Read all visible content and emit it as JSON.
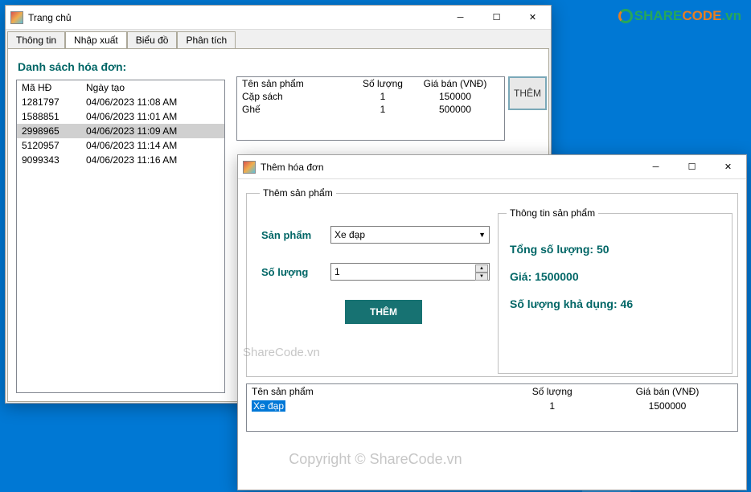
{
  "logo": {
    "text1": "SHARE",
    "text2": "CODE",
    "ext": ".vn"
  },
  "watermarks": {
    "center": "Copyright © ShareCode.vn",
    "small": "ShareCode.vn"
  },
  "mainWindow": {
    "title": "Trang chủ",
    "tabs": [
      "Thông tin",
      "Nhập xuất",
      "Biểu đồ",
      "Phân tích"
    ],
    "sectionTitle": "Danh sách hóa đơn:",
    "listHeaders": {
      "id": "Mã HĐ",
      "date": "Ngày tạo"
    },
    "invoices": [
      {
        "id": "1281797",
        "date": "04/06/2023 11:08 AM"
      },
      {
        "id": "1588851",
        "date": "04/06/2023 11:01 AM"
      },
      {
        "id": "2998965",
        "date": "04/06/2023 11:09 AM"
      },
      {
        "id": "5120957",
        "date": "04/06/2023 11:14 AM"
      },
      {
        "id": "9099343",
        "date": "04/06/2023 11:16 AM"
      }
    ],
    "selectedIndex": 2,
    "detailHeaders": {
      "name": "Tên sản phẩm",
      "qty": "Số lượng",
      "price": "Giá bán (VNĐ)"
    },
    "details": [
      {
        "name": "Cặp sách",
        "qty": "1",
        "price": "150000"
      },
      {
        "name": "Ghế",
        "qty": "1",
        "price": "500000"
      }
    ],
    "addButton": "THÊM"
  },
  "dialog": {
    "title": "Thêm hóa đơn",
    "groupTitle": "Thêm sản phẩm",
    "infoGroupTitle": "Thông tin sản phẩm",
    "labels": {
      "product": "Sản phẩm",
      "quantity": "Số lượng"
    },
    "productValue": "Xe đạp",
    "quantityValue": "1",
    "info": {
      "totalLabel": "Tổng số lượng: ",
      "totalValue": "50",
      "priceLabel": "Giá: ",
      "priceValue": "1500000",
      "availLabel": "Số lượng khả dụng: ",
      "availValue": "46"
    },
    "addButton": "THÊM",
    "gridHeaders": {
      "name": "Tên sản phẩm",
      "qty": "Số lượng",
      "price": "Giá bán (VNĐ)"
    },
    "gridRows": [
      {
        "name": "Xe đạp",
        "qty": "1",
        "price": "1500000"
      }
    ]
  }
}
